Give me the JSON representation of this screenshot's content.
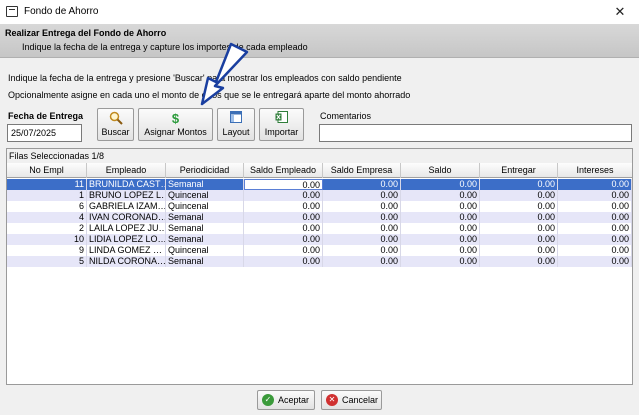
{
  "window": {
    "title": "Fondo de Ahorro",
    "close_glyph": "✕"
  },
  "header": {
    "title": "Realizar Entrega del Fondo de Ahorro",
    "subtitle": "Indique la fecha de la entrega y capture los importes de cada empleado"
  },
  "instructions": {
    "line1": "Indique la fecha de la entrega y presione 'Buscar' para mostrar los empleados con saldo pendiente",
    "line2": "Opcionalmente asigne en cada uno el monto de otros que se le entregará aparte del monto ahorrado"
  },
  "form": {
    "date_label": "Fecha de Entrega",
    "date_value": "25/07/2025",
    "comments_label": "Comentarios",
    "comments_value": ""
  },
  "toolbar": {
    "buscar": {
      "label": "Buscar",
      "icon": "magnifier-icon"
    },
    "asignar": {
      "label": "Asignar Montos",
      "icon": "dollar-icon"
    },
    "layout": {
      "label": "Layout",
      "icon": "layout-icon"
    },
    "importar": {
      "label": "Importar",
      "icon": "excel-import-icon"
    }
  },
  "grid": {
    "selection_text": "Filas Seleccionadas 1/8",
    "columns": [
      "No Empl",
      "Empleado",
      "Periodicidad",
      "Saldo Empleado",
      "Saldo Empresa",
      "Saldo",
      "Entregar",
      "Intereses"
    ],
    "rows": [
      {
        "no": "11",
        "empleado": "BRUNILDA CAST…",
        "periodicidad": "Semanal",
        "saldo_empleado": "0.00",
        "saldo_empresa": "0.00",
        "saldo": "0.00",
        "entregar": "0.00",
        "intereses": "0.00"
      },
      {
        "no": "1",
        "empleado": "BRUNO LOPEZ L…",
        "periodicidad": "Quincenal",
        "saldo_empleado": "0.00",
        "saldo_empresa": "0.00",
        "saldo": "0.00",
        "entregar": "0.00",
        "intereses": "0.00"
      },
      {
        "no": "6",
        "empleado": "GABRIELA IZAM…",
        "periodicidad": "Quincenal",
        "saldo_empleado": "0.00",
        "saldo_empresa": "0.00",
        "saldo": "0.00",
        "entregar": "0.00",
        "intereses": "0.00"
      },
      {
        "no": "4",
        "empleado": "IVAN CORONAD…",
        "periodicidad": "Semanal",
        "saldo_empleado": "0.00",
        "saldo_empresa": "0.00",
        "saldo": "0.00",
        "entregar": "0.00",
        "intereses": "0.00"
      },
      {
        "no": "2",
        "empleado": "LAILA LOPEZ JU…",
        "periodicidad": "Semanal",
        "saldo_empleado": "0.00",
        "saldo_empresa": "0.00",
        "saldo": "0.00",
        "entregar": "0.00",
        "intereses": "0.00"
      },
      {
        "no": "10",
        "empleado": "LIDIA LOPEZ LO…",
        "periodicidad": "Semanal",
        "saldo_empleado": "0.00",
        "saldo_empresa": "0.00",
        "saldo": "0.00",
        "entregar": "0.00",
        "intereses": "0.00"
      },
      {
        "no": "9",
        "empleado": "LINDA GOMEZ …",
        "periodicidad": "Quincenal",
        "saldo_empleado": "0.00",
        "saldo_empresa": "0.00",
        "saldo": "0.00",
        "entregar": "0.00",
        "intereses": "0.00"
      },
      {
        "no": "5",
        "empleado": "NILDA CORONA…",
        "periodicidad": "Semanal",
        "saldo_empleado": "0.00",
        "saldo_empresa": "0.00",
        "saldo": "0.00",
        "entregar": "0.00",
        "intereses": "0.00"
      }
    ]
  },
  "footer": {
    "aceptar": {
      "label": "Aceptar",
      "icon": "check-icon"
    },
    "cancelar": {
      "label": "Cancelar",
      "icon": "cancel-icon"
    }
  },
  "colors": {
    "selected_row": "#3c6ec8",
    "alt_row": "#e6e6f8",
    "accept_green": "#3a9a3a",
    "cancel_red": "#d03030"
  }
}
